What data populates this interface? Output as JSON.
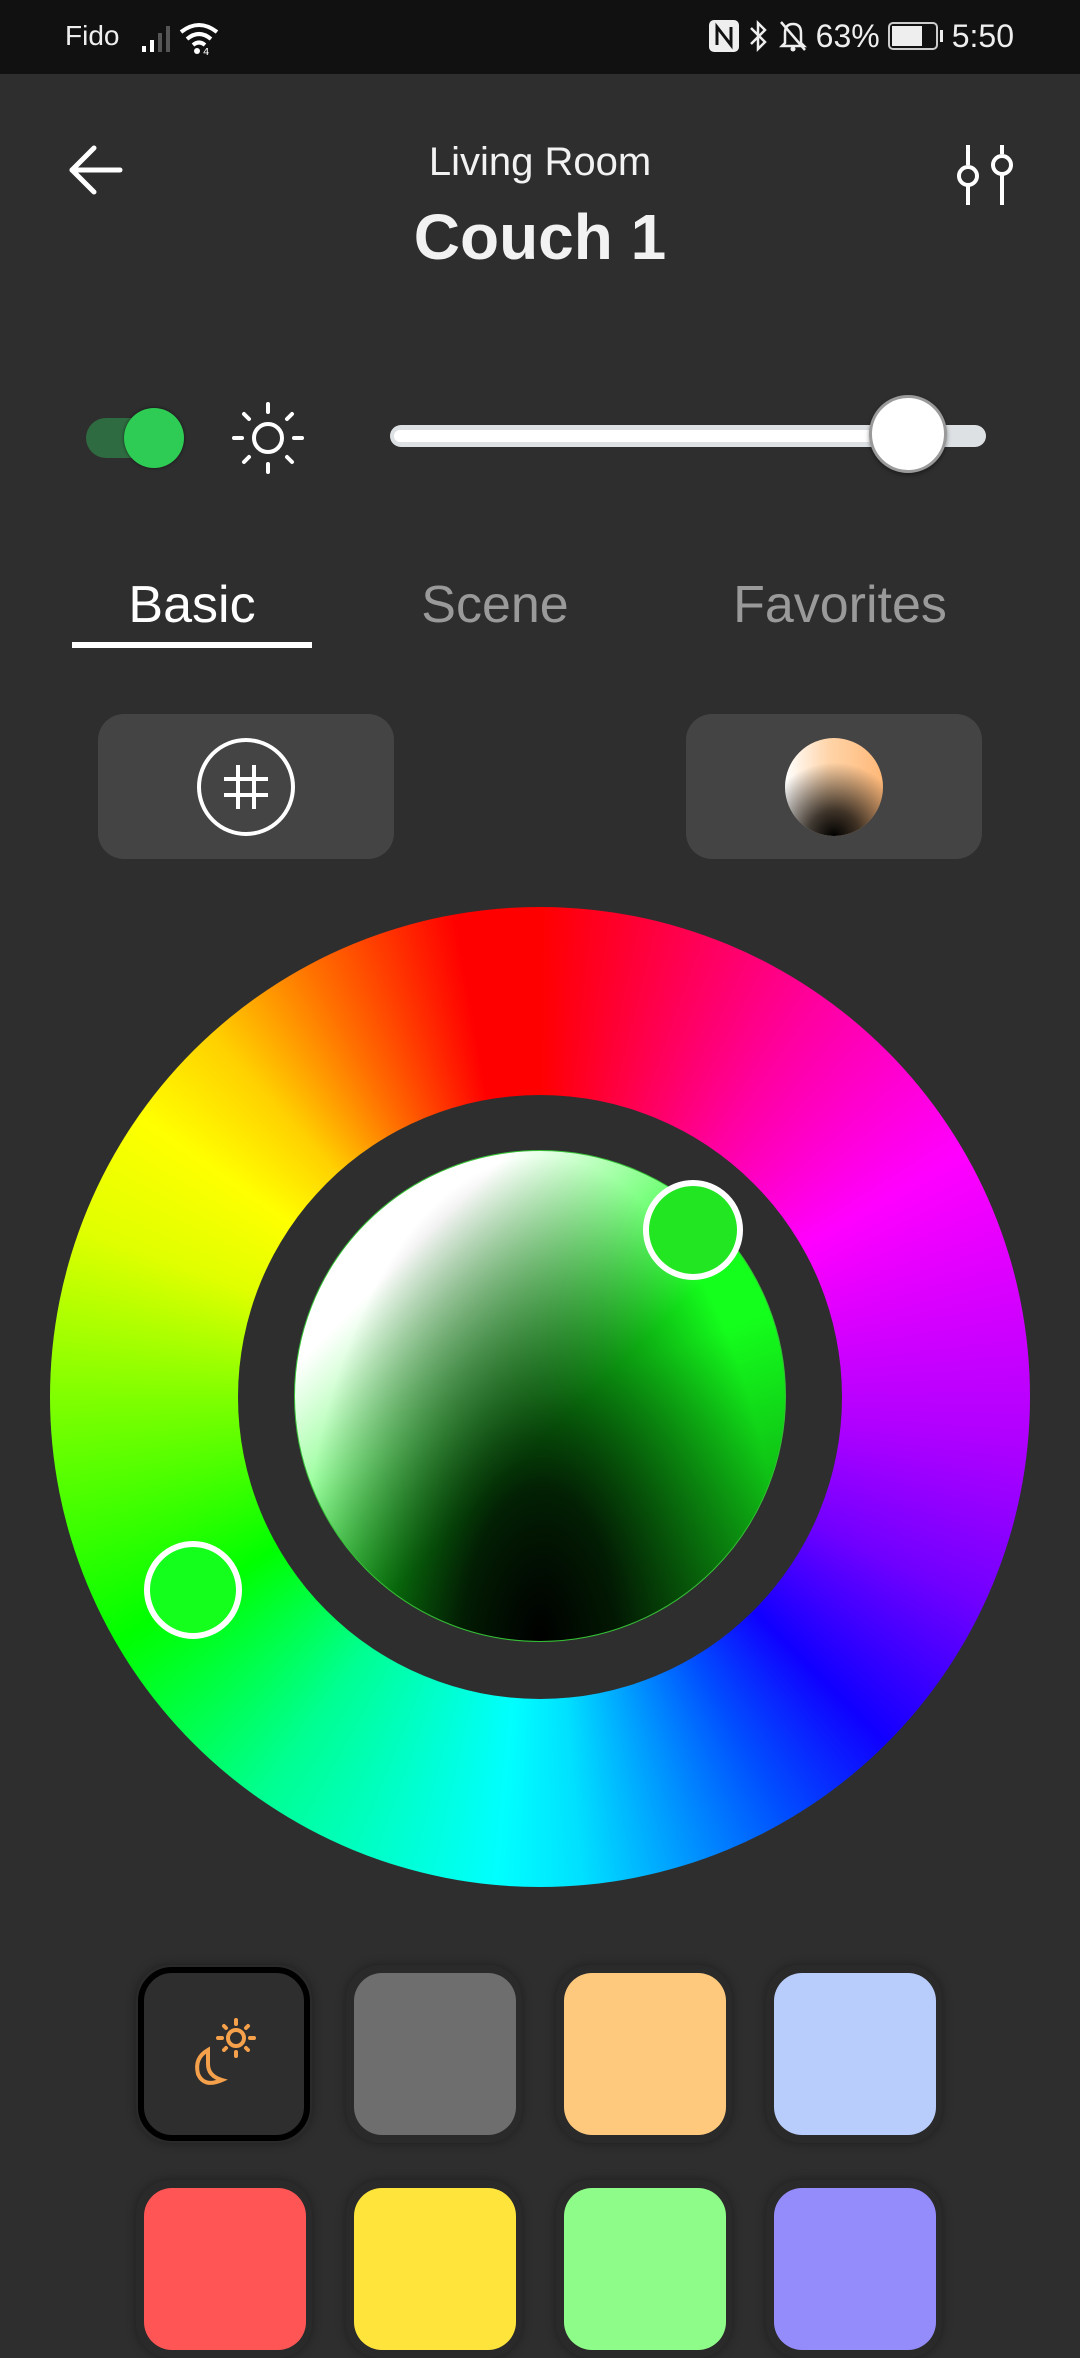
{
  "status_bar": {
    "carrier": "Fido",
    "battery_percent": "63%",
    "time": "5:50",
    "icons": [
      "signal-icon",
      "wifi-icon",
      "nfc-icon",
      "bluetooth-icon",
      "bell-off-icon",
      "battery-icon"
    ]
  },
  "header": {
    "room": "Living Room",
    "device": "Couch 1",
    "back_icon": "arrow-left-icon",
    "settings_icon": "sliders-icon"
  },
  "controls": {
    "power_on": true,
    "toggle_color": "#2ecc55",
    "brightness_icon": "sun-icon",
    "brightness_percent": 88
  },
  "tabs": [
    {
      "label": "Basic",
      "active": true
    },
    {
      "label": "Scene",
      "active": false
    },
    {
      "label": "Favorites",
      "active": false
    }
  ],
  "mode_buttons": [
    {
      "name": "color-grid-mode",
      "icon": "hash-circle-icon"
    },
    {
      "name": "white-temperature-mode",
      "icon": "sphere-icon"
    }
  ],
  "color_picker": {
    "selected_hue_deg": 120,
    "selected_color": "#22e622",
    "hue_handle_color": "#14ff1c",
    "sv_handle_color": "#22e622"
  },
  "swatches": [
    {
      "type": "icon",
      "icon": "day-night-icon",
      "icon_color": "#f5a04a"
    },
    {
      "type": "color",
      "color": "#6e6e6e"
    },
    {
      "type": "color",
      "color": "#ffc97d"
    },
    {
      "type": "color",
      "color": "#b8cdfc"
    },
    {
      "type": "color",
      "color": "#ff5555"
    },
    {
      "type": "color",
      "color": "#ffe53b"
    },
    {
      "type": "color",
      "color": "#8efc88"
    },
    {
      "type": "color",
      "color": "#958cfc"
    }
  ]
}
